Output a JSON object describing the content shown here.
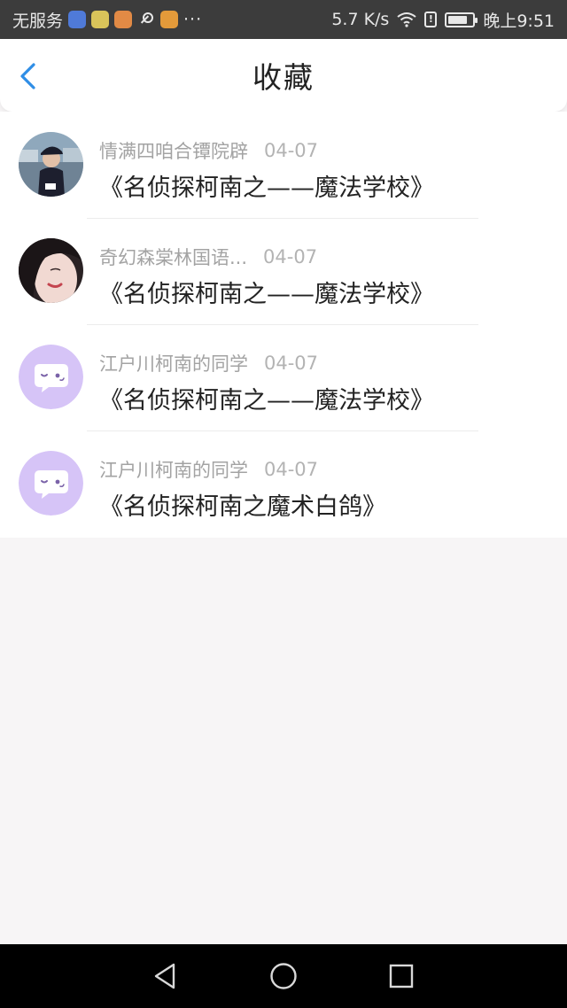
{
  "status_bar": {
    "carrier": "无服务",
    "more": "···",
    "speed": "5.7 K/s",
    "time": "晚上9:51",
    "battery_level": 0.8,
    "icons": [
      "music-app-icon",
      "chat-app-icon",
      "video-app-icon",
      "key-icon",
      "box-app-icon",
      "wifi-icon",
      "alert-icon",
      "battery-icon"
    ]
  },
  "header": {
    "title": "收藏",
    "back_icon": "chevron-left-icon",
    "accent_color": "#2f8ee6"
  },
  "favorites": [
    {
      "name": "情满四咱合镡院辟",
      "date": "04-07",
      "title": "《名侦探柯南之——魔法学校》",
      "avatar": "photo-avatar-cap"
    },
    {
      "name": "奇幻森棠林国语...",
      "date": "04-07",
      "title": "《名侦探柯南之——魔法学校》",
      "avatar": "photo-avatar-girl"
    },
    {
      "name": "江户川柯南的同学",
      "date": "04-07",
      "title": "《名侦探柯南之——魔法学校》",
      "avatar": "default-chat-avatar"
    },
    {
      "name": "江户川柯南的同学",
      "date": "04-07",
      "title": "《名侦探柯南之魔术白鸽》",
      "avatar": "default-chat-avatar"
    }
  ],
  "colors": {
    "default_avatar": "#d6c4f7",
    "default_avatar_face": "#7a62a8"
  },
  "nav_bar": {
    "icons": [
      "back-triangle-icon",
      "home-circle-icon",
      "recents-square-icon"
    ]
  }
}
